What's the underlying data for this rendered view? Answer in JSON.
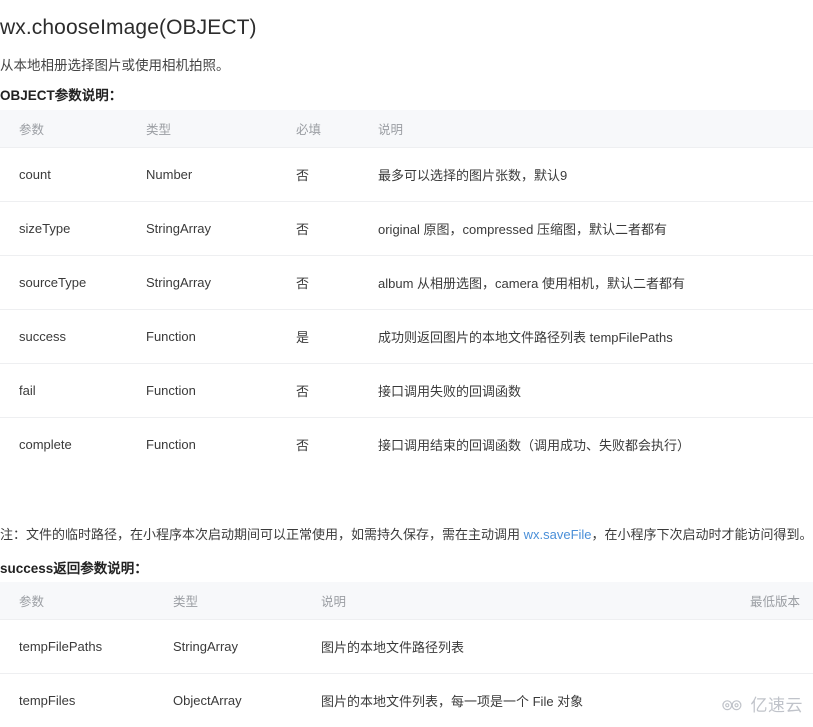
{
  "doc": {
    "title": "wx.chooseImage(OBJECT)",
    "description": "从本地相册选择图片或使用相机拍照。",
    "section_object_heading": "OBJECT参数说明：",
    "section_success_heading": "success返回参数说明："
  },
  "note": {
    "before_link": "注：文件的临时路径，在小程序本次启动期间可以正常使用，如需持久保存，需在主动调用 ",
    "link_text": "wx.saveFile",
    "after_link": "，在小程序下次启动时才能访问得到。",
    "link_color": "#4a8fd8"
  },
  "object_table": {
    "headers": [
      "参数",
      "类型",
      "必填",
      "说明"
    ],
    "rows": [
      {
        "name": "count",
        "type": "Number",
        "required": "否",
        "desc": "最多可以选择的图片张数，默认9"
      },
      {
        "name": "sizeType",
        "type": "StringArray",
        "required": "否",
        "desc": "original 原图，compressed 压缩图，默认二者都有"
      },
      {
        "name": "sourceType",
        "type": "StringArray",
        "required": "否",
        "desc": "album 从相册选图，camera 使用相机，默认二者都有"
      },
      {
        "name": "success",
        "type": "Function",
        "required": "是",
        "desc": "成功则返回图片的本地文件路径列表 tempFilePaths"
      },
      {
        "name": "fail",
        "type": "Function",
        "required": "否",
        "desc": "接口调用失败的回调函数"
      },
      {
        "name": "complete",
        "type": "Function",
        "required": "否",
        "desc": "接口调用结束的回调函数（调用成功、失败都会执行）"
      }
    ]
  },
  "success_table": {
    "headers": [
      "参数",
      "类型",
      "说明",
      "最低版本"
    ],
    "rows": [
      {
        "name": "tempFilePaths",
        "type": "StringArray",
        "desc": "图片的本地文件路径列表",
        "min_version": ""
      },
      {
        "name": "tempFiles",
        "type": "ObjectArray",
        "desc": "图片的本地文件列表，每一项是一个 File 对象",
        "min_version": ""
      }
    ]
  },
  "watermark": {
    "text": "亿速云",
    "color": "#9aa0aa"
  },
  "theme": {
    "page_background": "#ffffff",
    "header_background": "#f7f8fa",
    "divider": "#eeeff1",
    "text": "#333333",
    "muted_text": "#9b9ea3"
  }
}
